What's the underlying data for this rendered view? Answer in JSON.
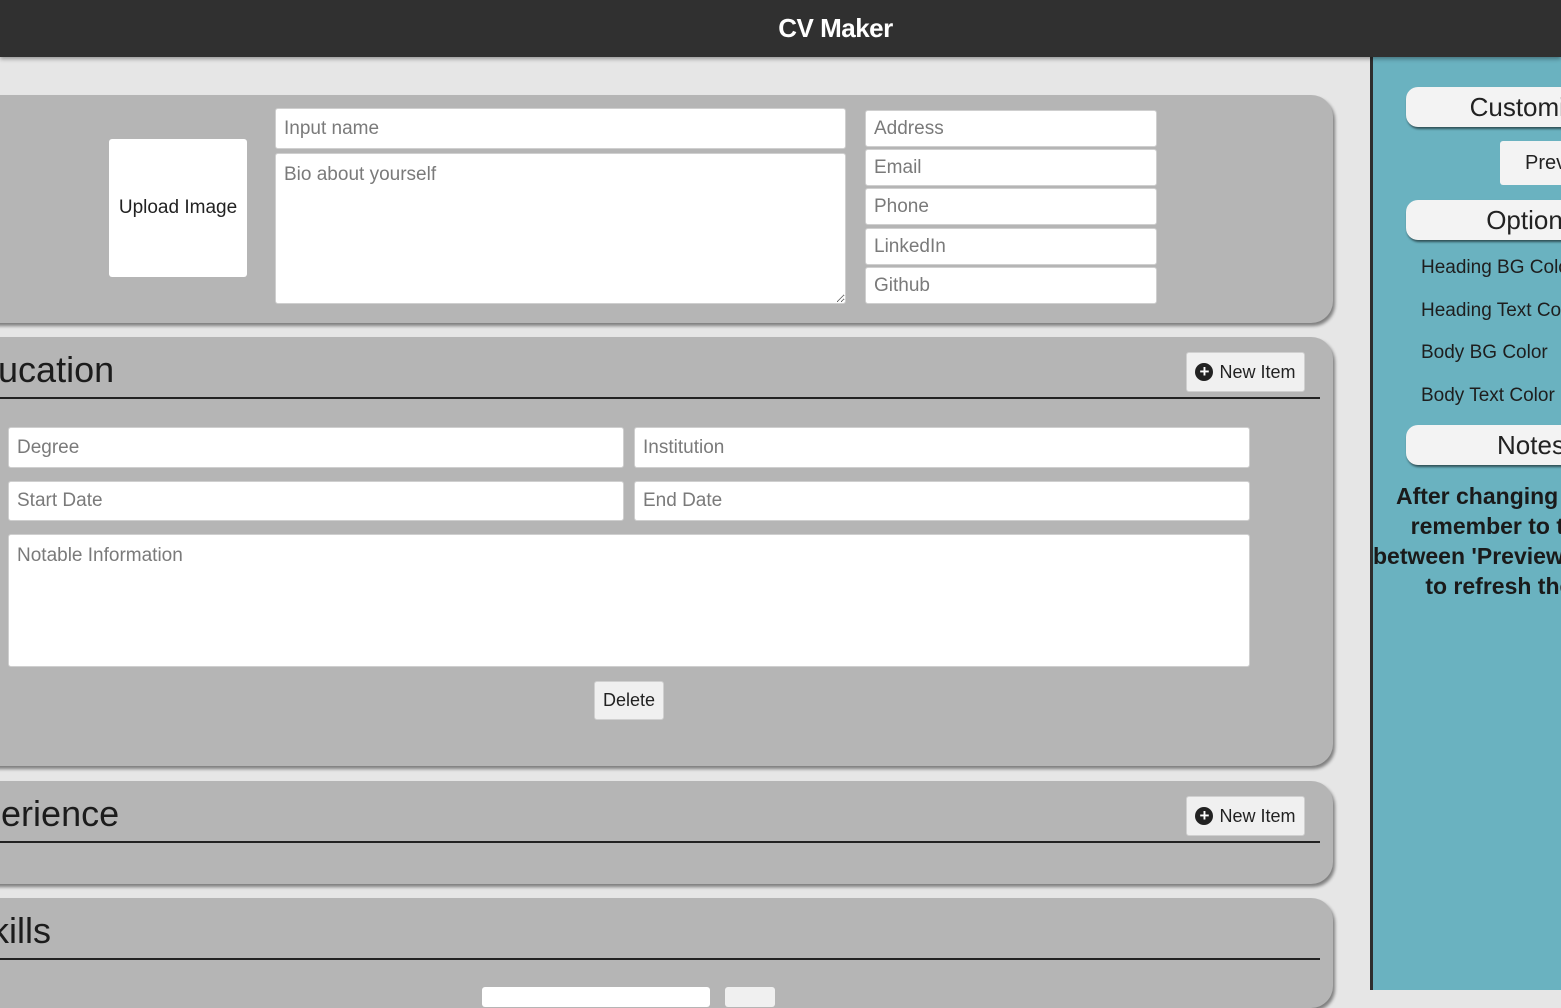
{
  "app": {
    "title": "CV Maker"
  },
  "header_section": {
    "upload_label": "Upload Image",
    "name_placeholder": "Input name",
    "bio_placeholder": "Bio about yourself",
    "address_placeholder": "Address",
    "email_placeholder": "Email",
    "phone_placeholder": "Phone",
    "linkedin_placeholder": "LinkedIn",
    "github_placeholder": "Github"
  },
  "education": {
    "title": "Education",
    "new_item_label": "New Item",
    "degree_placeholder": "Degree",
    "institution_placeholder": "Institution",
    "start_placeholder": "Start Date",
    "end_placeholder": "End Date",
    "notes_placeholder": "Notable Information",
    "delete_label": "Delete"
  },
  "experience": {
    "title": "Experience",
    "new_item_label": "New Item"
  },
  "skills": {
    "title": "Skills"
  },
  "sidebar": {
    "customize_label": "Customize",
    "preview_label": "Preview",
    "options_label": "Options",
    "options": [
      "Heading BG Color",
      "Heading Text Color",
      "Body BG Color",
      "Body Text Color"
    ],
    "notes_label": "Notes",
    "notes_lines": [
      "After changing colors,",
      "remember to toggle",
      "between 'Preview' and 'Edit'",
      "to refresh the CV"
    ]
  },
  "colors": {
    "topbar": "#303030",
    "panel": "#b5b5b5",
    "sidebar": "#6ab2c0",
    "background": "#e6e6e6"
  }
}
